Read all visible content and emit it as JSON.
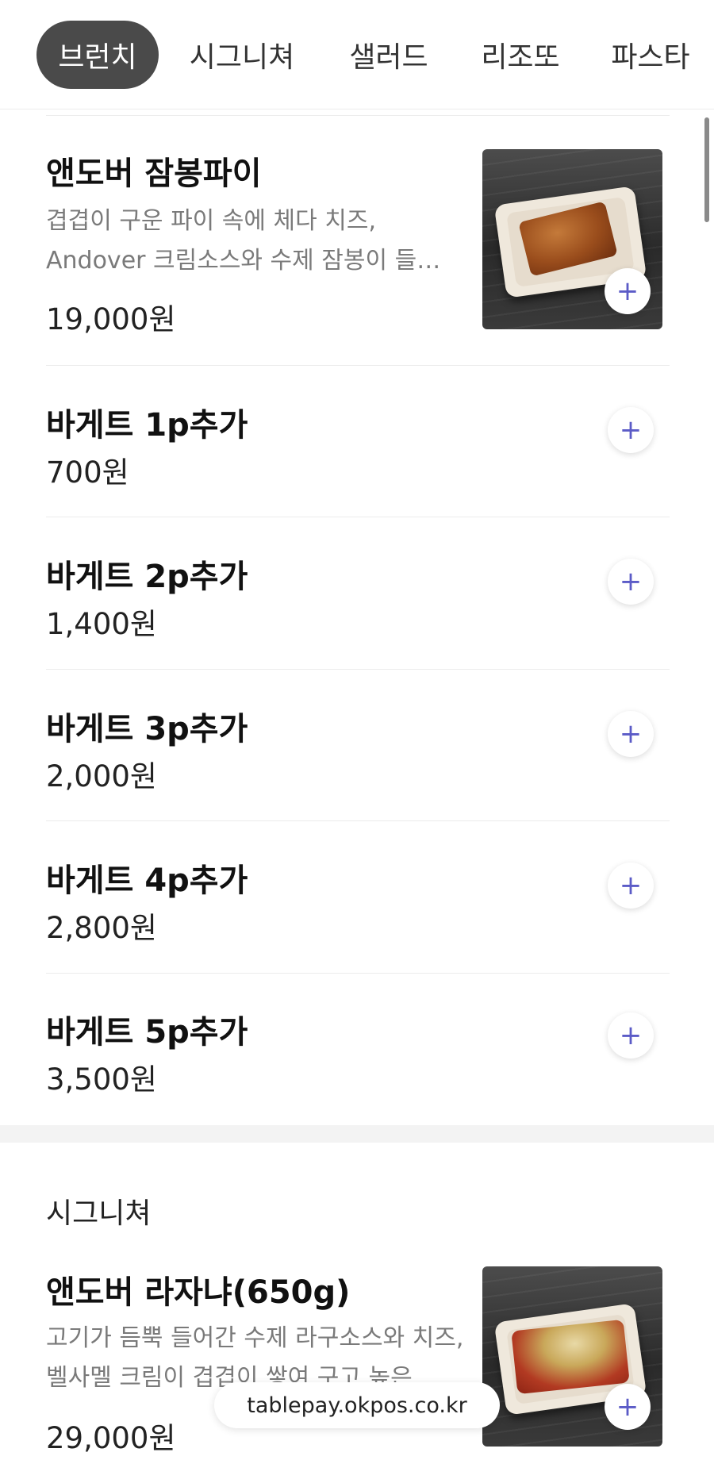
{
  "tabs": [
    "브런치",
    "시그니쳐",
    "샐러드",
    "리조또",
    "파스타"
  ],
  "brunch_items": {
    "jambong_pie": {
      "name": "앤도버 잠봉파이",
      "desc_line1": "겹겹이 구운 파이 속에 체다 치즈,",
      "desc_line2": "Andover 크림소스와 수제 잠봉이 들…",
      "price": "19,000원",
      "image_icon": "food-photo-pie"
    },
    "baguette_1p": {
      "name": "바게트 1p추가",
      "price": "700원"
    },
    "baguette_2p": {
      "name": "바게트 2p추가",
      "price": "1,400원"
    },
    "baguette_3p": {
      "name": "바게트 3p추가",
      "price": "2,000원"
    },
    "baguette_4p": {
      "name": "바게트 4p추가",
      "price": "2,800원"
    },
    "baguette_5p": {
      "name": "바게트 5p추가",
      "price": "3,500원"
    }
  },
  "signature_section": {
    "title": "시그니쳐",
    "lasagna": {
      "name": "앤도버 라자냐(650g)",
      "desc_line1": "고기가 듬뿍 들어간 수제 라구소스와 치즈,",
      "desc_line2": "벨사멜 크림이 겹겹이 쌓여 구고 높은 …",
      "price": "29,000원",
      "image_icon": "food-photo-lasagna"
    }
  },
  "add_button_symbol": "+",
  "url_bar": "tablepay.okpos.co.kr",
  "colors": {
    "active_tab_bg": "#4a4a4a",
    "plus_accent": "#5b5bc7"
  }
}
